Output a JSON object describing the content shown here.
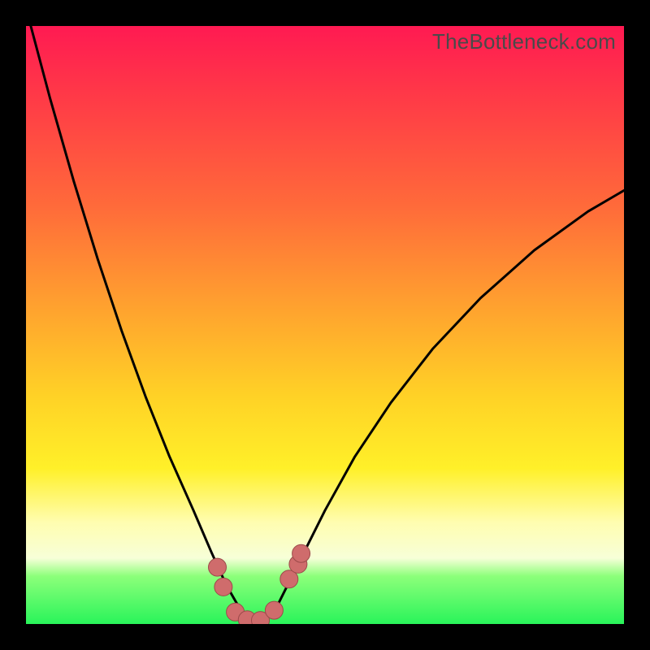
{
  "watermark": "TheBottleneck.com",
  "colors": {
    "frame": "#000000",
    "grad_top": "#ff1a52",
    "grad_mid1": "#ff6a3a",
    "grad_mid2": "#ffd226",
    "grad_mid3": "#fffdb0",
    "grad_bottom": "#29f45a",
    "curve": "#000000",
    "marker_fill": "#cf6c6c",
    "marker_stroke": "#9c4a4a"
  },
  "chart_data": {
    "type": "line",
    "title": "",
    "xlabel": "",
    "ylabel": "",
    "xlim": [
      0,
      1
    ],
    "ylim": [
      0,
      1
    ],
    "series": [
      {
        "name": "bottleneck-curve",
        "x": [
          0.0,
          0.04,
          0.08,
          0.12,
          0.16,
          0.2,
          0.24,
          0.28,
          0.31,
          0.335,
          0.355,
          0.37,
          0.385,
          0.4,
          0.42,
          0.44,
          0.465,
          0.5,
          0.55,
          0.61,
          0.68,
          0.76,
          0.85,
          0.94,
          1.0
        ],
        "y": [
          1.03,
          0.88,
          0.74,
          0.61,
          0.49,
          0.38,
          0.28,
          0.19,
          0.12,
          0.065,
          0.03,
          0.01,
          0.003,
          0.01,
          0.03,
          0.07,
          0.12,
          0.19,
          0.28,
          0.37,
          0.46,
          0.545,
          0.625,
          0.69,
          0.725
        ]
      }
    ],
    "markers": {
      "name": "highlight-points",
      "x": [
        0.32,
        0.33,
        0.35,
        0.37,
        0.392,
        0.415,
        0.44,
        0.455,
        0.46
      ],
      "y": [
        0.095,
        0.062,
        0.02,
        0.007,
        0.006,
        0.023,
        0.075,
        0.1,
        0.118
      ]
    }
  }
}
